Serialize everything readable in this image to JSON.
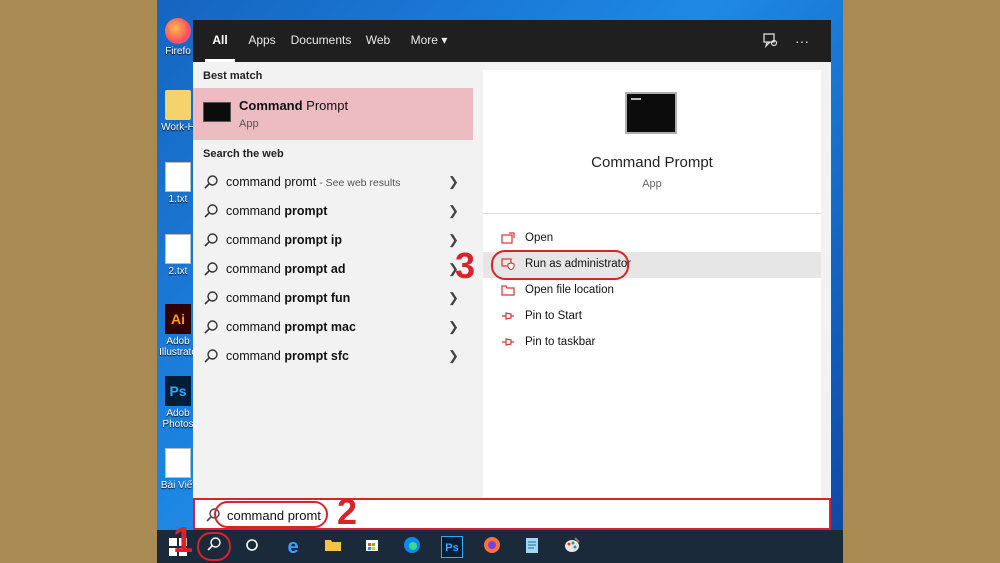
{
  "desktop": {
    "icons": [
      {
        "label": "Firefo",
        "icon": "firefox-icon"
      },
      {
        "label": "Work-H",
        "icon": "folder-icon"
      },
      {
        "label": "1.txt",
        "icon": "text-file-icon"
      },
      {
        "label": "2.txt",
        "icon": "text-file-icon"
      },
      {
        "label": "Adob Illustrato",
        "glyph": "Ai",
        "icon": "illustrator-icon"
      },
      {
        "label": "Adob Photos",
        "glyph": "Ps",
        "icon": "photoshop-icon"
      },
      {
        "label": "Bài Viết",
        "icon": "text-file-icon"
      }
    ]
  },
  "search_menu": {
    "tabs": [
      {
        "label": "All",
        "active": true
      },
      {
        "label": "Apps",
        "active": false
      },
      {
        "label": "Documents",
        "active": false
      },
      {
        "label": "Web",
        "active": false
      },
      {
        "label": "More",
        "active": false
      }
    ],
    "more_caret": "▾",
    "top_icons": [
      "feedback-icon",
      "more-options-icon"
    ],
    "more_options_glyph": "···",
    "best_match": {
      "header": "Best match",
      "title_bold": "Command",
      "title_rest": " Prompt",
      "subtitle": "App"
    },
    "web": {
      "header": "Search the web",
      "items": [
        {
          "normal": "command promt",
          "bold": "",
          "suffix": " - See web results"
        },
        {
          "normal": "command ",
          "bold": "prompt",
          "suffix": ""
        },
        {
          "normal": "command ",
          "bold": "prompt ip",
          "suffix": ""
        },
        {
          "normal": "command ",
          "bold": "prompt ad",
          "suffix": ""
        },
        {
          "normal": "command ",
          "bold": "prompt fun",
          "suffix": ""
        },
        {
          "normal": "command ",
          "bold": "prompt mac",
          "suffix": ""
        },
        {
          "normal": "command ",
          "bold": "prompt sfc",
          "suffix": ""
        }
      ]
    },
    "preview": {
      "title": "Command Prompt",
      "subtitle": "App",
      "actions": [
        {
          "label": "Open",
          "icon": "open-icon"
        },
        {
          "label": "Run as administrator",
          "icon": "shield-icon"
        },
        {
          "label": "Open file location",
          "icon": "folder-icon"
        },
        {
          "label": "Pin to Start",
          "icon": "pin-icon"
        },
        {
          "label": "Pin to taskbar",
          "icon": "pin-icon"
        }
      ]
    }
  },
  "search_box": {
    "value": "command promt"
  },
  "annotations": {
    "step1": "1",
    "step2": "2",
    "step3": "3"
  },
  "colors": {
    "annotation_red": "#d8232a",
    "best_match_bg": "#edbcc3",
    "topbar_bg": "#1f1f1f"
  }
}
